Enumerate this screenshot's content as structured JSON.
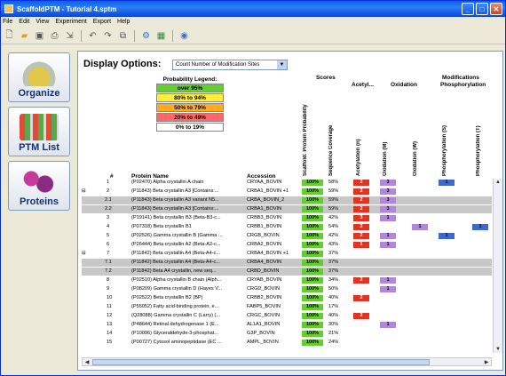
{
  "window": {
    "title": "ScaffoldPTM - Tutorial 4.sptm"
  },
  "menu": [
    "File",
    "Edit",
    "View",
    "Experiment",
    "Export",
    "Help"
  ],
  "nav": [
    {
      "label": "Organize"
    },
    {
      "label": "PTM List"
    },
    {
      "label": "Proteins"
    }
  ],
  "display": {
    "label": "Display Options:",
    "selected": "Count Number of Modification Sites"
  },
  "legend": {
    "title": "Probability Legend:",
    "items": [
      {
        "label": "over 95%",
        "color": "#66cc33"
      },
      {
        "label": "80% to 94%",
        "color": "#ffee33"
      },
      {
        "label": "50% to 79%",
        "color": "#ffaa22"
      },
      {
        "label": "20% to 49%",
        "color": "#ff6666"
      },
      {
        "label": "0% to 19%",
        "color": "#ffffff"
      }
    ]
  },
  "headers": {
    "num": "#",
    "name": "Protein Name",
    "accession": "Accession",
    "scores": "Scores",
    "modifications": "Modifications",
    "acetyl": "Acetyl...",
    "oxidation": "Oxidation",
    "phospho": "Phosphorylation",
    "score_cols": [
      "Scaffold: Protein Probability",
      "Sequence Coverage"
    ],
    "mod_cols": [
      "Acetylation (n)",
      "Oxidation (M)",
      "Oxidation (W)",
      "Phosphorylation (S)",
      "Phosphorylation (T)"
    ]
  },
  "colors": {
    "prob": "#66cc33",
    "red": "#e03322",
    "purple": "#b088d8",
    "blue": "#3f68c8"
  },
  "rows": [
    {
      "num": "1",
      "name": "(P02470) Alpha crystallin A chain",
      "acc": "CRYAA_BOVIN",
      "prob": "100%",
      "cov": "58%",
      "ac": "2",
      "ox": "3",
      "oxw": "",
      "ps": "1",
      "pt": "",
      "grey": false
    },
    {
      "num": "2",
      "name": "(P11843) Beta crystallin A3 [Contains:...",
      "acc": "CRBA1_BOVIN +1",
      "prob": "100%",
      "cov": "59%",
      "ac": "2",
      "ox": "3",
      "oxw": "",
      "ps": "",
      "pt": "",
      "grey": false,
      "group": true
    },
    {
      "num": "2.1",
      "name": "(P11843) Beta crystallin A3 variant N5...",
      "acc": "CRBA_BOVIN_2",
      "prob": "100%",
      "cov": "59%",
      "ac": "2",
      "ox": "3",
      "oxw": "",
      "ps": "",
      "pt": "",
      "grey": true
    },
    {
      "num": "2.2",
      "name": "(P11843) Beta crystallin A3 [Contains:...",
      "acc": "CRBA1_BOVIN",
      "prob": "100%",
      "cov": "59%",
      "ac": "2",
      "ox": "3",
      "oxw": "",
      "ps": "",
      "pt": "",
      "grey": true
    },
    {
      "num": "3",
      "name": "(P19141) Beta crystallin B3 (Beta-B3-c...",
      "acc": "CRBB3_BOVIN",
      "prob": "100%",
      "cov": "42%",
      "ac": "3",
      "ox": "1",
      "oxw": "",
      "ps": "",
      "pt": "",
      "grey": false
    },
    {
      "num": "4",
      "name": "(P07318) Beta crystallin B1",
      "acc": "CRBB1_BOVIN",
      "prob": "100%",
      "cov": "54%",
      "ac": "2",
      "ox": "",
      "oxw": "1",
      "ps": "",
      "pt": "1",
      "grey": false
    },
    {
      "num": "5",
      "name": "(P02526) Gamma crystallin B (Gamma ...",
      "acc": "CRGB_BOVIN",
      "prob": "100%",
      "cov": "42%",
      "ac": "2",
      "ox": "1",
      "oxw": "",
      "ps": "1",
      "pt": "",
      "grey": false
    },
    {
      "num": "6",
      "name": "(P26444) Beta crystallin A2 (Beta-A2-c...",
      "acc": "CRBA2_BOVIN",
      "prob": "100%",
      "cov": "43%",
      "ac": "1",
      "ox": "1",
      "oxw": "",
      "ps": "",
      "pt": "",
      "grey": false
    },
    {
      "num": "7",
      "name": "(P11842) Beta crystallin A4 (Beta-A4-c...",
      "acc": "CRBA4_BOVIN +1",
      "prob": "100%",
      "cov": "37%",
      "ac": "",
      "ox": "",
      "oxw": "",
      "ps": "",
      "pt": "",
      "grey": false,
      "group": true
    },
    {
      "num": "7.1",
      "name": "(P11842) Beta crystallin A4 (Beta-A4-c...",
      "acc": "CRBA4_BOVIN",
      "prob": "100%",
      "cov": "37%",
      "ac": "",
      "ox": "",
      "oxw": "",
      "ps": "",
      "pt": "",
      "grey": true
    },
    {
      "num": "7.2",
      "name": "(P11842) Beta A4 crystallin, new seq...",
      "acc": "CRBD_BOVIN",
      "prob": "100%",
      "cov": "37%",
      "ac": "",
      "ox": "",
      "oxw": "",
      "ps": "",
      "pt": "",
      "grey": true
    },
    {
      "num": "8",
      "name": "(P02510) Alpha crystallin B chain (Alph...",
      "acc": "CRYAB_BOVIN",
      "prob": "100%",
      "cov": "34%",
      "ac": "2",
      "ox": "1",
      "oxw": "",
      "ps": "",
      "pt": "",
      "grey": false
    },
    {
      "num": "9",
      "name": "(P08209) Gamma crystallin D (Hayes V...",
      "acc": "CRGD_BOVIN",
      "prob": "100%",
      "cov": "50%",
      "ac": "",
      "ox": "1",
      "oxw": "",
      "ps": "",
      "pt": "",
      "grey": false
    },
    {
      "num": "10",
      "name": "(P02522) Beta crystallin B2 (BP)",
      "acc": "CRBB2_BOVIN",
      "prob": "100%",
      "cov": "40%",
      "ac": "2",
      "ox": "",
      "oxw": "",
      "ps": "",
      "pt": "",
      "grey": false
    },
    {
      "num": "11",
      "name": "(P55052) Fatty acid-binding protein, e...",
      "acc": "FABP5_BOVIN",
      "prob": "100%",
      "cov": "17%",
      "ac": "",
      "ox": "",
      "oxw": "",
      "ps": "",
      "pt": "",
      "grey": false
    },
    {
      "num": "12",
      "name": "(Q28088) Gamma crystallin C (Larry) (...",
      "acc": "CRGC_BOVIN",
      "prob": "100%",
      "cov": "40%",
      "ac": "2",
      "ox": "",
      "oxw": "",
      "ps": "",
      "pt": "",
      "grey": false
    },
    {
      "num": "13",
      "name": "(P48644) Retinal dehydrogenase 1 (E...",
      "acc": "AL1A1_BOVIN",
      "prob": "100%",
      "cov": "30%",
      "ac": "",
      "ox": "1",
      "oxw": "",
      "ps": "",
      "pt": "",
      "grey": false
    },
    {
      "num": "14",
      "name": "(P10096) Glyceraldehyde-3-phosphat...",
      "acc": "G3P_BOVIN",
      "prob": "100%",
      "cov": "21%",
      "ac": "",
      "ox": "",
      "oxw": "",
      "ps": "",
      "pt": "",
      "grey": false
    },
    {
      "num": "15",
      "name": "(P00727) Cytosol aminopeptidase (EC ...",
      "acc": "AMPL_BOVIN",
      "prob": "100%",
      "cov": "24%",
      "ac": "",
      "ox": "",
      "oxw": "",
      "ps": "",
      "pt": "",
      "grey": false
    }
  ]
}
